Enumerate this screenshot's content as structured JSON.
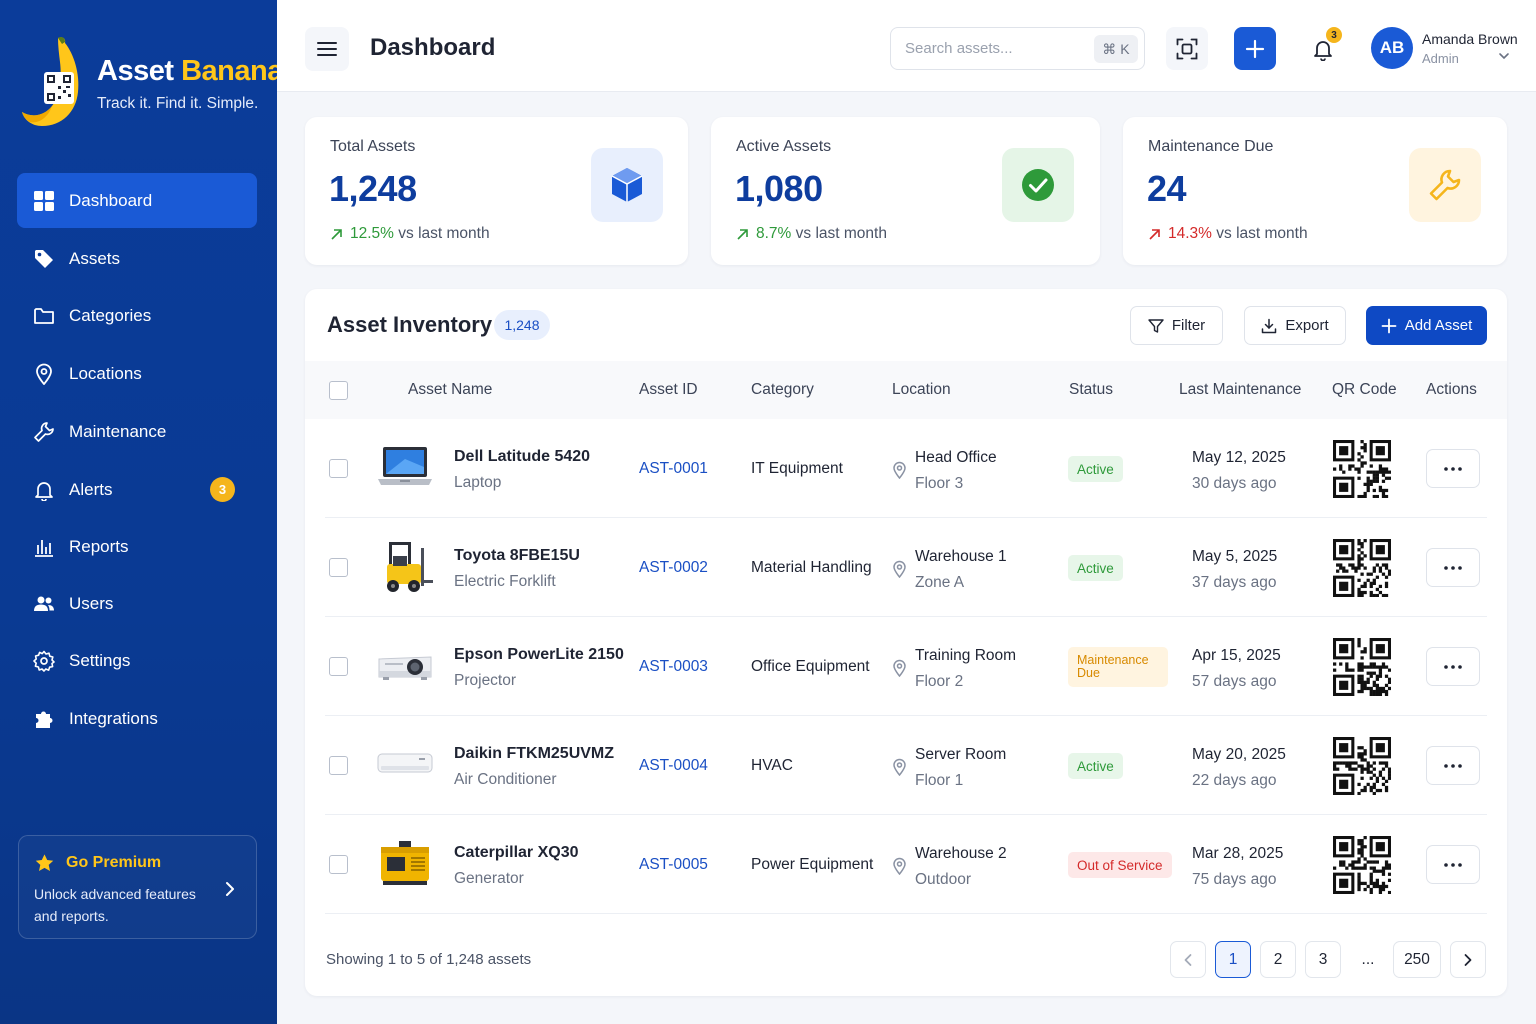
{
  "brand": {
    "name_part1": "Asset",
    "name_part2": "Banana",
    "tagline": "Track it. Find it. Simple."
  },
  "nav": [
    {
      "label": "Dashboard",
      "icon": "grid-icon",
      "active": true
    },
    {
      "label": "Assets",
      "icon": "tag-icon"
    },
    {
      "label": "Categories",
      "icon": "folder-icon"
    },
    {
      "label": "Locations",
      "icon": "map-pin-icon"
    },
    {
      "label": "Maintenance",
      "icon": "wrench-icon"
    },
    {
      "label": "Alerts",
      "icon": "bell-icon",
      "badge": "3"
    },
    {
      "label": "Reports",
      "icon": "bar-chart-icon"
    },
    {
      "label": "Users",
      "icon": "users-icon"
    },
    {
      "label": "Settings",
      "icon": "gear-icon"
    },
    {
      "label": "Integrations",
      "icon": "puzzle-icon"
    }
  ],
  "premium": {
    "title": "Go Premium",
    "desc": "Unlock advanced features and reports."
  },
  "header": {
    "title": "Dashboard",
    "search_placeholder": "Search assets...",
    "search_shortcut": "⌘ K",
    "notif_count": "3",
    "user": {
      "initials": "AB",
      "name": "Amanda Brown",
      "role": "Admin"
    }
  },
  "stats": [
    {
      "title": "Total Assets",
      "value": "1,248",
      "change": "12.5%",
      "suffix": "vs last month",
      "direction": "up",
      "trend_color": "#2e9a3a",
      "icon": "cube-icon"
    },
    {
      "title": "Active Assets",
      "value": "1,080",
      "change": "8.7%",
      "suffix": "vs last month",
      "direction": "up",
      "trend_color": "#2e9a3a",
      "icon": "check-circle-icon"
    },
    {
      "title": "Maintenance Due",
      "value": "24",
      "change": "14.3%",
      "suffix": "vs last month",
      "direction": "up",
      "trend_color": "#d42a2a",
      "icon": "wrench-icon"
    }
  ],
  "inventory": {
    "title": "Asset Inventory",
    "count": "1,248",
    "filter_label": "Filter",
    "export_label": "Export",
    "add_label": "Add Asset",
    "columns": [
      "Asset Name",
      "Asset ID",
      "Category",
      "Location",
      "Status",
      "Last Maintenance",
      "QR Code",
      "Actions"
    ],
    "rows": [
      {
        "name": "Dell Latitude 5420",
        "type": "Laptop",
        "id": "AST-0001",
        "category": "IT Equipment",
        "location": "Head Office",
        "sublocation": "Floor 3",
        "status": "Active",
        "status_kind": "active",
        "date": "May 12, 2025",
        "ago": "30 days ago",
        "thumb": "laptop-image"
      },
      {
        "name": "Toyota 8FBE15U",
        "type": "Electric Forklift",
        "id": "AST-0002",
        "category": "Material Handling",
        "location": "Warehouse 1",
        "sublocation": "Zone A",
        "status": "Active",
        "status_kind": "active",
        "date": "May 5, 2025",
        "ago": "37 days ago",
        "thumb": "forklift-image"
      },
      {
        "name": "Epson PowerLite 2150",
        "type": "Projector",
        "id": "AST-0003",
        "category": "Office Equipment",
        "location": "Training Room",
        "sublocation": "Floor 2",
        "status": "Maintenance Due",
        "status_kind": "maintenance",
        "date": "Apr 15, 2025",
        "ago": "57 days ago",
        "thumb": "projector-image"
      },
      {
        "name": "Daikin FTKM25UVMZ",
        "type": "Air Conditioner",
        "id": "AST-0004",
        "category": "HVAC",
        "location": "Server Room",
        "sublocation": "Floor 1",
        "status": "Active",
        "status_kind": "active",
        "date": "May 20, 2025",
        "ago": "22 days ago",
        "thumb": "air-conditioner-image"
      },
      {
        "name": "Caterpillar XQ30",
        "type": "Generator",
        "id": "AST-0005",
        "category": "Power Equipment",
        "location": "Warehouse 2",
        "sublocation": "Outdoor",
        "status": "Out of Service",
        "status_kind": "out",
        "date": "Mar 28, 2025",
        "ago": "75 days ago",
        "thumb": "generator-image"
      }
    ],
    "showing": "Showing 1 to 5 of 1,248 assets",
    "pages": [
      "1",
      "2",
      "3",
      "...",
      "250"
    ],
    "current_page": "1"
  }
}
